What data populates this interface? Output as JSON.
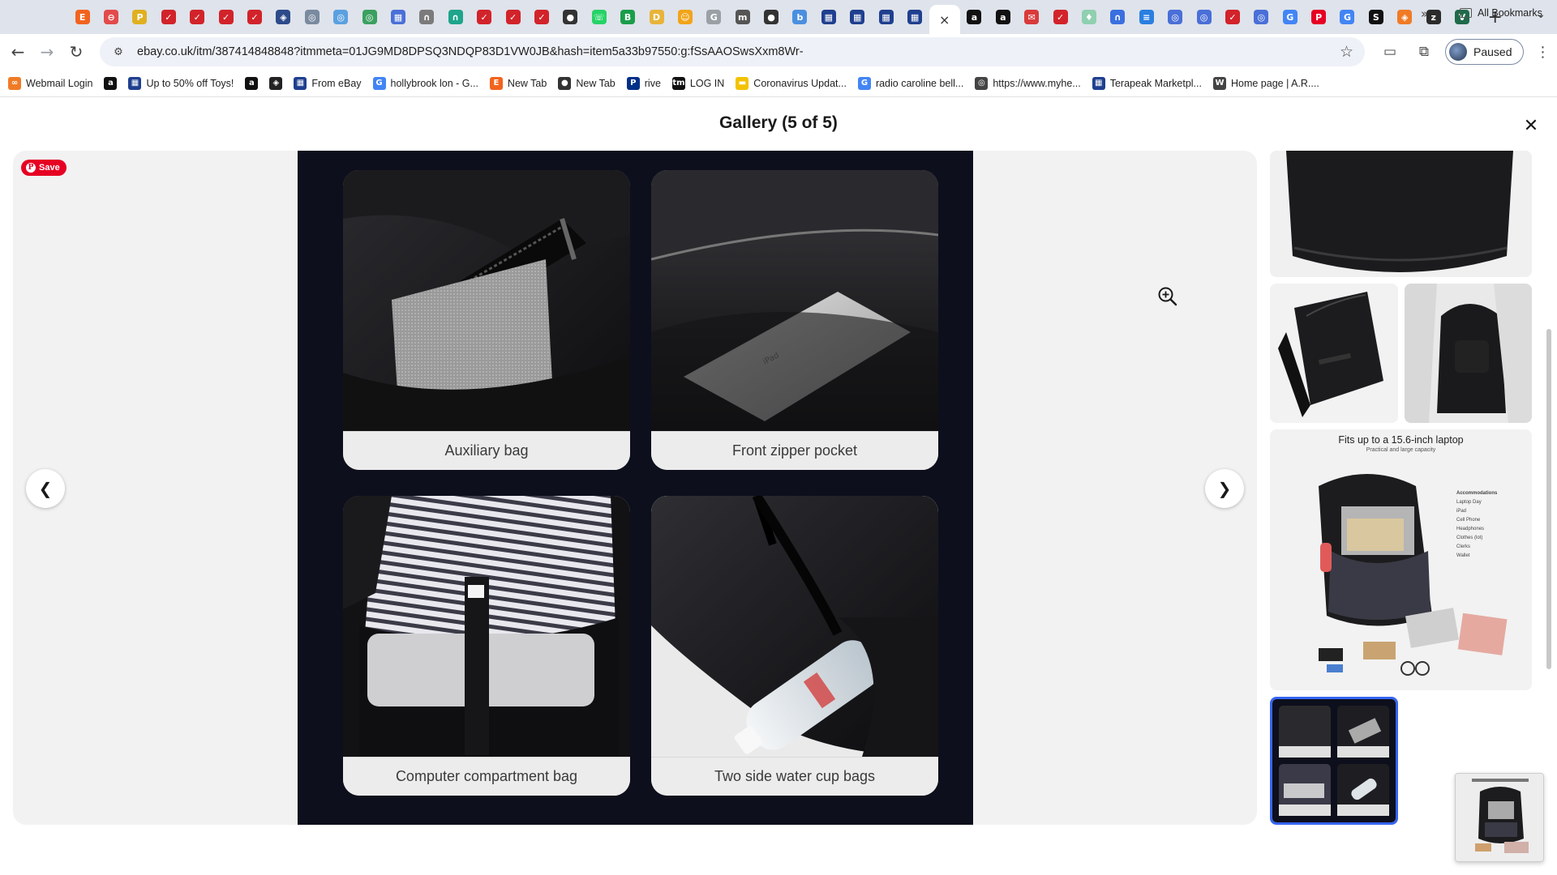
{
  "browser": {
    "active_tab_close": "×",
    "new_tab": "+",
    "url": "ebay.co.uk/itm/387414848848?itmmeta=01JG9MD8DPSQ3NDQP83D1VW0JB&hash=item5a33b97550:g:fSsAAOSwsXxm8Wr-",
    "profile_label": "Paused",
    "tab_favicons": [
      {
        "icon": "etsy-icon",
        "color": "#f1641e",
        "glyph": "E"
      },
      {
        "icon": "no-entry-icon",
        "color": "#e24b4b",
        "glyph": "⊖"
      },
      {
        "icon": "pt-icon",
        "color": "#e0b020",
        "glyph": "P"
      },
      {
        "icon": "swoosh-icon",
        "color": "#d2232a",
        "glyph": "✓"
      },
      {
        "icon": "swoosh-icon",
        "color": "#d2232a",
        "glyph": "✓"
      },
      {
        "icon": "swoosh-icon",
        "color": "#d2232a",
        "glyph": "✓"
      },
      {
        "icon": "swoosh-icon",
        "color": "#d2232a",
        "glyph": "✓"
      },
      {
        "icon": "app-icon",
        "color": "#2d4a8a",
        "glyph": "◈"
      },
      {
        "icon": "globe-icon",
        "color": "#7a8aa0",
        "glyph": "◎"
      },
      {
        "icon": "globe-icon",
        "color": "#5aa0e0",
        "glyph": "◎"
      },
      {
        "icon": "chart-icon",
        "color": "#3aa060",
        "glyph": "◎"
      },
      {
        "icon": "shop-icon",
        "color": "#4a6fd8",
        "glyph": "▦"
      },
      {
        "icon": "arch-icon",
        "color": "#7b7b7b",
        "glyph": "∩"
      },
      {
        "icon": "arch-icon",
        "color": "#1ea58c",
        "glyph": "∩"
      },
      {
        "icon": "swoosh-icon",
        "color": "#d2232a",
        "glyph": "✓"
      },
      {
        "icon": "swoosh-icon",
        "color": "#d2232a",
        "glyph": "✓"
      },
      {
        "icon": "swoosh-icon",
        "color": "#d2232a",
        "glyph": "✓"
      },
      {
        "icon": "github-icon",
        "color": "#333333",
        "glyph": "●"
      },
      {
        "icon": "whatsapp-icon",
        "color": "#25d366",
        "glyph": "☏"
      },
      {
        "icon": "b-icon",
        "color": "#1a9e4a",
        "glyph": "B"
      },
      {
        "icon": "d-icon",
        "color": "#e8b43a",
        "glyph": "D"
      },
      {
        "icon": "emoji-icon",
        "color": "#f2a41a",
        "glyph": "☺"
      },
      {
        "icon": "g-icon",
        "color": "#9aa0a6",
        "glyph": "G"
      },
      {
        "icon": "m-icon",
        "color": "#555555",
        "glyph": "m"
      },
      {
        "icon": "github-icon",
        "color": "#333333",
        "glyph": "●"
      },
      {
        "icon": "bee-icon",
        "color": "#4a8fe0",
        "glyph": "b"
      },
      {
        "icon": "shop-icon",
        "color": "#1f3f8f",
        "glyph": "▦"
      },
      {
        "icon": "shop-icon",
        "color": "#1f3f8f",
        "glyph": "▦"
      },
      {
        "icon": "shop-icon",
        "color": "#1f3f8f",
        "glyph": "▦"
      },
      {
        "icon": "shop-icon",
        "color": "#1f3f8f",
        "glyph": "▦"
      }
    ],
    "tab_favicons_after_active": [
      {
        "icon": "amazon-icon",
        "color": "#111111",
        "glyph": "a"
      },
      {
        "icon": "amazon-icon",
        "color": "#111111",
        "glyph": "a"
      },
      {
        "icon": "mail-icon",
        "color": "#d93a3a",
        "glyph": "✉"
      },
      {
        "icon": "swoosh-icon",
        "color": "#d2232a",
        "glyph": "✓"
      },
      {
        "icon": "tooth-icon",
        "color": "#8fd0b0",
        "glyph": "♦"
      },
      {
        "icon": "arch-icon",
        "color": "#3a6fe0",
        "glyph": "∩"
      },
      {
        "icon": "doc-icon",
        "color": "#2a7fe0",
        "glyph": "≡"
      },
      {
        "icon": "globe-icon",
        "color": "#4a6fd8",
        "glyph": "◎"
      },
      {
        "icon": "globe-icon",
        "color": "#4a6fd8",
        "glyph": "◎"
      },
      {
        "icon": "swoosh-icon",
        "color": "#d2232a",
        "glyph": "✓"
      },
      {
        "icon": "globe-icon",
        "color": "#4a6fd8",
        "glyph": "◎"
      },
      {
        "icon": "google-icon",
        "color": "#4285f4",
        "glyph": "G"
      },
      {
        "icon": "pinterest-icon",
        "color": "#e60023",
        "glyph": "P"
      },
      {
        "icon": "google-icon",
        "color": "#4285f4",
        "glyph": "G"
      },
      {
        "icon": "s-icon",
        "color": "#111111",
        "glyph": "S"
      },
      {
        "icon": "shield-icon",
        "color": "#f07b26",
        "glyph": "◈"
      },
      {
        "icon": "zz-icon",
        "color": "#2b2b2b",
        "glyph": "z"
      },
      {
        "icon": "v-icon",
        "color": "#1e6b4a",
        "glyph": "V"
      }
    ]
  },
  "bookmarks": [
    {
      "label": "Webmail Login",
      "icon": "webmail-icon",
      "color": "#f07b26",
      "glyph": "∞"
    },
    {
      "label": "",
      "icon": "amazon-icon",
      "color": "#111111",
      "glyph": "a"
    },
    {
      "label": "Up to 50% off Toys!",
      "icon": "shop-icon",
      "color": "#1f3f8f",
      "glyph": "▦"
    },
    {
      "label": "",
      "icon": "amazon-icon",
      "color": "#111111",
      "glyph": "a"
    },
    {
      "label": "",
      "icon": "app-icon",
      "color": "#222222",
      "glyph": "◈"
    },
    {
      "label": "From eBay",
      "icon": "shop-icon",
      "color": "#1f3f8f",
      "glyph": "▦"
    },
    {
      "label": "hollybrook lon - G...",
      "icon": "google-icon",
      "color": "#4285f4",
      "glyph": "G"
    },
    {
      "label": "New Tab",
      "icon": "etsy-icon",
      "color": "#f1641e",
      "glyph": "E"
    },
    {
      "label": "New Tab",
      "icon": "github-icon",
      "color": "#333333",
      "glyph": "●"
    },
    {
      "label": "rive",
      "icon": "paypal-icon",
      "color": "#003087",
      "glyph": "P"
    },
    {
      "label": "LOG IN",
      "icon": "tm-icon",
      "color": "#111111",
      "glyph": "tm"
    },
    {
      "label": "Coronavirus Updat...",
      "icon": "news-icon",
      "color": "#f2c300",
      "glyph": "▬"
    },
    {
      "label": "radio caroline bell...",
      "icon": "google-icon",
      "color": "#4285f4",
      "glyph": "G"
    },
    {
      "label": "https://www.myhe...",
      "icon": "globe-icon",
      "color": "#444444",
      "glyph": "◎"
    },
    {
      "label": "Terapeak Marketpl...",
      "icon": "shop-icon",
      "color": "#1f3f8f",
      "glyph": "▦"
    },
    {
      "label": "Home page | A.R....",
      "icon": "w-icon",
      "color": "#444444",
      "glyph": "W"
    }
  ],
  "bookmarks_more": "»",
  "all_bookmarks": "All Bookmarks",
  "gallery": {
    "title": "Gallery (5 of 5)",
    "close": "✕",
    "pin_label": "Save",
    "prev": "❮",
    "next": "❯",
    "captions": [
      "Auxiliary bag",
      "Front zipper pocket",
      "Computer compartment bag",
      "Two side water cup bags"
    ]
  },
  "thumbnails": {
    "thumb4_title": "Fits up to a 15.6-inch laptop",
    "thumb4_subtitle": "Practical and large capacity",
    "thumb4_list_title": "Accommodations",
    "thumb4_list": [
      "Laptop Day",
      "iPad",
      "Cell Phone",
      "Headphones",
      "Clothes (lot)",
      "Clerks",
      "Wallet"
    ]
  }
}
